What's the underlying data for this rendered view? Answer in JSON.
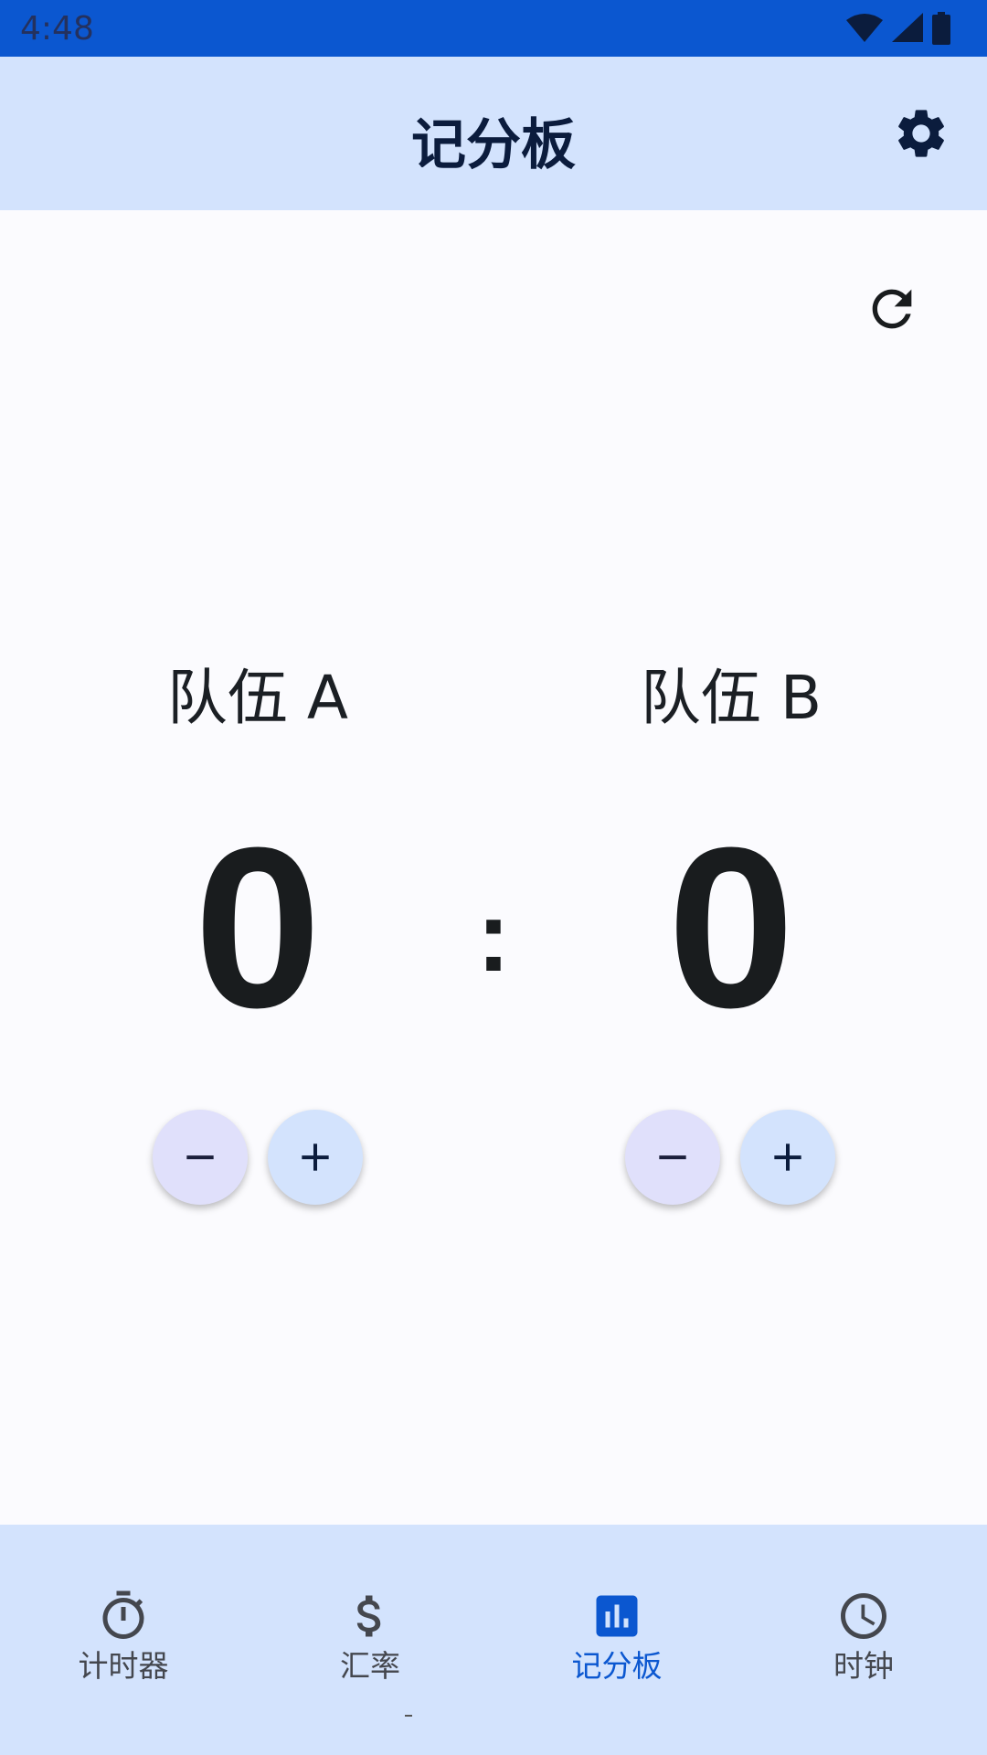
{
  "status_bar": {
    "time": "4:48"
  },
  "app_bar": {
    "title": "记分板"
  },
  "scoreboard": {
    "team_a": {
      "name": "队伍 A",
      "score": "0"
    },
    "team_b": {
      "name": "队伍 B",
      "score": "0"
    },
    "separator": ":"
  },
  "bottom_nav": {
    "items": [
      {
        "label": "计时器",
        "icon": "timer-icon"
      },
      {
        "label": "汇率",
        "icon": "dollar-icon"
      },
      {
        "label": "记分板",
        "icon": "bar-chart-icon",
        "active": true
      },
      {
        "label": "时钟",
        "icon": "clock-icon"
      }
    ]
  },
  "colors": {
    "primary": "#0b57d0",
    "surface": "#d3e3fd",
    "background": "#fbfbfe"
  }
}
